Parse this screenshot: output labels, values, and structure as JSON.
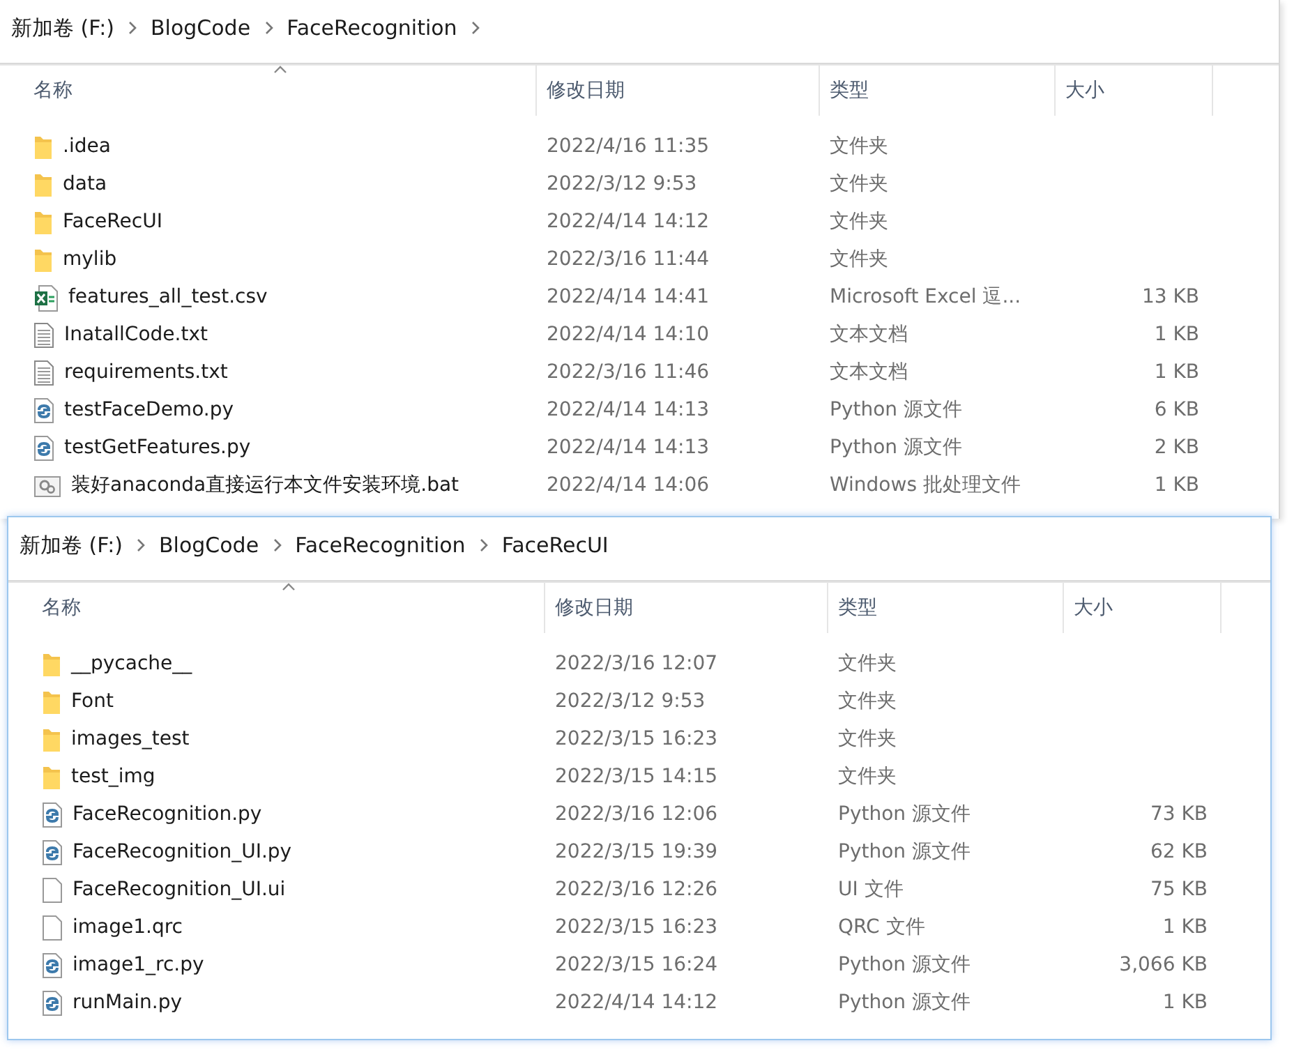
{
  "windows": [
    {
      "breadcrumb": [
        "新加卷 (F:)",
        "BlogCode",
        "FaceRecognition"
      ],
      "trailing_chevron": true,
      "focused": false,
      "columns": [
        "名称",
        "修改日期",
        "类型",
        "大小"
      ],
      "files": [
        {
          "kind": "folder",
          "name": ".idea",
          "modified": "2022/4/16 11:35",
          "type": "文件夹"
        },
        {
          "kind": "folder",
          "name": "data",
          "modified": "2022/3/12 9:53",
          "type": "文件夹"
        },
        {
          "kind": "folder",
          "name": "FaceRecUI",
          "modified": "2022/4/14 14:12",
          "type": "文件夹"
        },
        {
          "kind": "folder",
          "name": "mylib",
          "modified": "2022/3/16 11:44",
          "type": "文件夹"
        },
        {
          "kind": "excel",
          "name": "features_all_test.csv",
          "modified": "2022/4/14 14:41",
          "type": "Microsoft Excel 逗...",
          "size": "13 KB"
        },
        {
          "kind": "text",
          "name": "InatallCode.txt",
          "modified": "2022/4/14 14:10",
          "type": "文本文档",
          "size": "1 KB"
        },
        {
          "kind": "text",
          "name": "requirements.txt",
          "modified": "2022/3/16 11:46",
          "type": "文本文档",
          "size": "1 KB"
        },
        {
          "kind": "python",
          "name": "testFaceDemo.py",
          "modified": "2022/4/14 14:13",
          "type": "Python 源文件",
          "size": "6 KB"
        },
        {
          "kind": "python",
          "name": "testGetFeatures.py",
          "modified": "2022/4/14 14:13",
          "type": "Python 源文件",
          "size": "2 KB"
        },
        {
          "kind": "batch",
          "name": "装好anaconda直接运行本文件安装环境.bat",
          "modified": "2022/4/14 14:06",
          "type": "Windows 批处理文件",
          "size": "1 KB"
        }
      ]
    },
    {
      "breadcrumb": [
        "新加卷 (F:)",
        "BlogCode",
        "FaceRecognition",
        "FaceRecUI"
      ],
      "trailing_chevron": false,
      "focused": true,
      "columns": [
        "名称",
        "修改日期",
        "类型",
        "大小"
      ],
      "files": [
        {
          "kind": "folder",
          "name": "__pycache__",
          "modified": "2022/3/16 12:07",
          "type": "文件夹"
        },
        {
          "kind": "folder",
          "name": "Font",
          "modified": "2022/3/12 9:53",
          "type": "文件夹"
        },
        {
          "kind": "folder",
          "name": "images_test",
          "modified": "2022/3/15 16:23",
          "type": "文件夹"
        },
        {
          "kind": "folder",
          "name": "test_img",
          "modified": "2022/3/15 14:15",
          "type": "文件夹"
        },
        {
          "kind": "python",
          "name": "FaceRecognition.py",
          "modified": "2022/3/16 12:06",
          "type": "Python 源文件",
          "size": "73 KB"
        },
        {
          "kind": "python",
          "name": "FaceRecognition_UI.py",
          "modified": "2022/3/15 19:39",
          "type": "Python 源文件",
          "size": "62 KB"
        },
        {
          "kind": "blank",
          "name": "FaceRecognition_UI.ui",
          "modified": "2022/3/16 12:26",
          "type": "UI 文件",
          "size": "75 KB"
        },
        {
          "kind": "blank",
          "name": "image1.qrc",
          "modified": "2022/3/15 16:23",
          "type": "QRC 文件",
          "size": "1 KB"
        },
        {
          "kind": "python",
          "name": "image1_rc.py",
          "modified": "2022/3/15 16:24",
          "type": "Python 源文件",
          "size": "3,066 KB"
        },
        {
          "kind": "python",
          "name": "runMain.py",
          "modified": "2022/4/14 14:12",
          "type": "Python 源文件",
          "size": "1 KB"
        }
      ]
    }
  ]
}
